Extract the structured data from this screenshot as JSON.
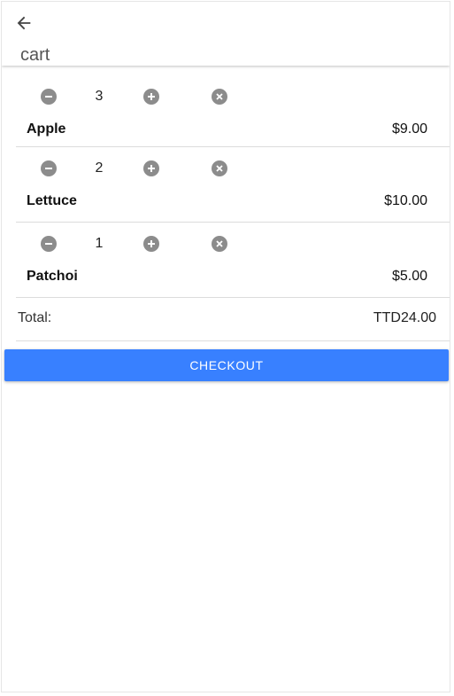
{
  "header": {
    "title": "cart",
    "back_icon": "arrow-back-icon"
  },
  "cart": {
    "items": [
      {
        "name": "Apple",
        "quantity": "3",
        "price": "$9.00"
      },
      {
        "name": "Lettuce",
        "quantity": "2",
        "price": "$10.00"
      },
      {
        "name": "Patchoi",
        "quantity": "1",
        "price": "$5.00"
      }
    ],
    "icons": {
      "decrease": "remove-circle-icon",
      "increase": "add-circle-icon",
      "remove": "close-circle-icon"
    },
    "total_label": "Total:",
    "total_value": "TTD24.00"
  },
  "checkout": {
    "label": "CHECKOUT"
  },
  "colors": {
    "primary": "#3880ff",
    "icon_gray": "#8c8c8c",
    "divider": "#dcdcdc"
  }
}
